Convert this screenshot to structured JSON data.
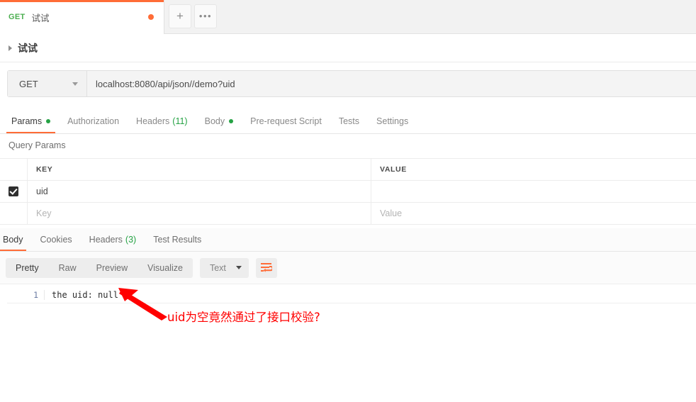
{
  "tabstrip": {
    "request_tab": {
      "method": "GET",
      "title": "试试",
      "unsaved_indicator": "unsaved-dot"
    },
    "new_tab_label": "+",
    "more_label": "•••"
  },
  "breadcrumb": {
    "caret": "caret-right-icon",
    "collection_name": "试试"
  },
  "urlbar": {
    "method": "GET",
    "method_caret": "chevron-down-icon",
    "url": "localhost:8080/api/json//demo?uid"
  },
  "request_tabs": [
    {
      "label": "Params",
      "active": true,
      "dot": true
    },
    {
      "label": "Authorization",
      "active": false,
      "dot": false
    },
    {
      "label": "Headers",
      "active": false,
      "count": "(11)"
    },
    {
      "label": "Body",
      "active": false,
      "dot": true
    },
    {
      "label": "Pre-request Script",
      "active": false
    },
    {
      "label": "Tests",
      "active": false
    },
    {
      "label": "Settings",
      "active": false
    }
  ],
  "query_params": {
    "section_title": "Query Params",
    "columns": {
      "key": "KEY",
      "value": "VALUE"
    },
    "rows": [
      {
        "checked": true,
        "key": "uid",
        "value": ""
      }
    ],
    "placeholder_row": {
      "key": "Key",
      "value": "Value"
    }
  },
  "response_tabs": [
    {
      "label": "Body",
      "active": true
    },
    {
      "label": "Cookies",
      "active": false
    },
    {
      "label": "Headers",
      "active": false,
      "count": "(3)"
    },
    {
      "label": "Test Results",
      "active": false
    }
  ],
  "response_toolbar": {
    "views": [
      {
        "label": "Pretty",
        "active": true
      },
      {
        "label": "Raw",
        "active": false
      },
      {
        "label": "Preview",
        "active": false
      },
      {
        "label": "Visualize",
        "active": false
      }
    ],
    "format": "Text",
    "format_caret": "chevron-down-icon",
    "wrap_icon": "word-wrap-icon"
  },
  "response_body": {
    "line_number": "1",
    "text": "the uid: null"
  },
  "annotation": {
    "text": "uid为空竟然通过了接口校验?",
    "arrow": "red-arrow-icon",
    "color": "#ff0000"
  },
  "colors": {
    "accent": "#ff6c37",
    "method_get": "#4caf50",
    "status_dot": "#25a244",
    "annotation": "#ff0000"
  }
}
